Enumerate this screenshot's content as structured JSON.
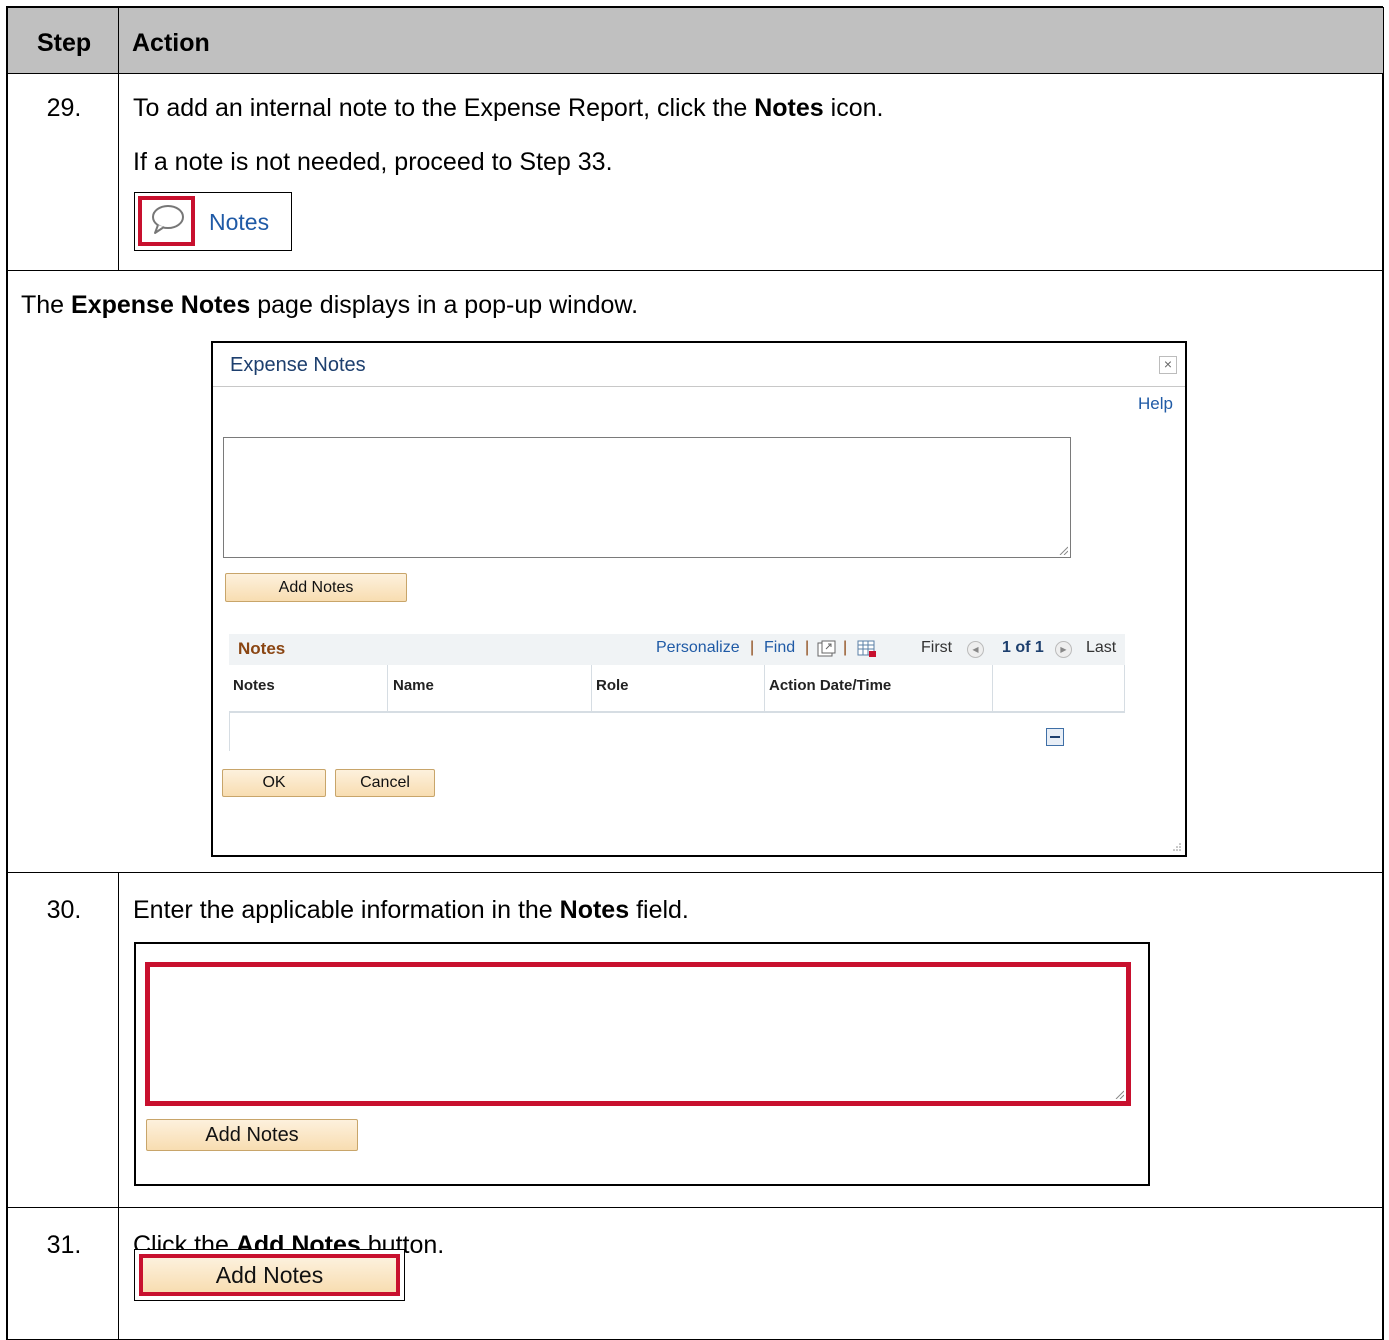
{
  "header": {
    "step": "Step",
    "action": "Action"
  },
  "step29": {
    "number": "29.",
    "line1": {
      "before": "To add an internal note to the Expense Report, click the ",
      "bold": "Notes",
      "after": " icon."
    },
    "line2": "If a note is not needed, proceed to Step 33.",
    "notes_link": "Notes"
  },
  "intro": {
    "before": "The ",
    "bold": "Expense Notes",
    "after": " page displays in a pop-up window."
  },
  "popup": {
    "title": "Expense Notes",
    "close": "×",
    "help": "Help",
    "add_notes": "Add Notes",
    "grid": {
      "title": "Notes",
      "personalize": "Personalize",
      "find": "Find",
      "first": "First",
      "count": "1 of 1",
      "last": "Last",
      "columns": [
        "Notes",
        "Name",
        "Role",
        "Action Date/Time"
      ]
    },
    "ok": "OK",
    "cancel": "Cancel"
  },
  "step30": {
    "number": "30.",
    "text": {
      "before": "Enter the applicable information in the ",
      "bold": "Notes",
      "after": " field."
    },
    "add_notes": "Add Notes"
  },
  "step31": {
    "number": "31.",
    "text": {
      "before": "Click the ",
      "bold": "Add Notes",
      "after": " button."
    },
    "add_notes": "Add Notes"
  },
  "colors": {
    "highlight": "#c8102e",
    "link": "#1f5aa6",
    "header_bg": "#c0c0c0",
    "grid_title": "#8a4512"
  }
}
